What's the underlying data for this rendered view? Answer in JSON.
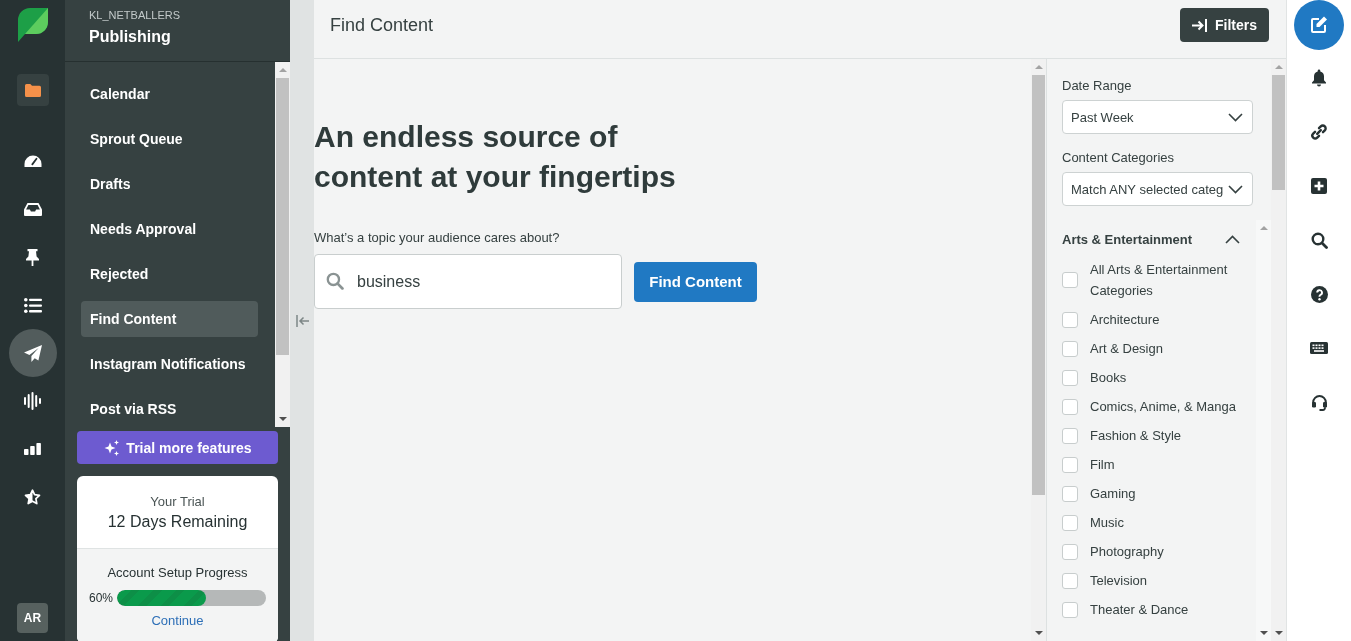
{
  "app_rail": {
    "nav": [
      {
        "selected": false
      },
      {
        "selected": false
      },
      {
        "selected": false
      },
      {
        "selected": false
      },
      {
        "selected": true
      },
      {
        "selected": false
      },
      {
        "selected": false
      },
      {
        "selected": false
      }
    ],
    "avatar": "AR"
  },
  "sidebar": {
    "account": "KL_NETBALLERS",
    "title": "Publishing",
    "items": [
      {
        "label": "Calendar",
        "selected": false
      },
      {
        "label": "Sprout Queue",
        "selected": false
      },
      {
        "label": "Drafts",
        "selected": false
      },
      {
        "label": "Needs Approval",
        "selected": false
      },
      {
        "label": "Rejected",
        "selected": false
      },
      {
        "label": "Find Content",
        "selected": true
      },
      {
        "label": "Instagram Notifications",
        "selected": false
      },
      {
        "label": "Post via RSS",
        "selected": false
      }
    ],
    "trial_button": "Trial more features",
    "trial_card": {
      "label": "Your Trial",
      "remaining": "12 Days Remaining",
      "progress_title": "Account Setup Progress",
      "progress": {
        "reading": "60%",
        "level": 0.6
      },
      "link": "Continue"
    }
  },
  "main": {
    "title": "Find Content",
    "filters_button": "Filters",
    "hero": {
      "headline": "An endless source of content at your fingertips",
      "search_label": "What’s a topic your audience cares about?",
      "search_value": "business",
      "search_button": "Find Content"
    }
  },
  "filters": {
    "date_range": {
      "label": "Date Range",
      "value": "Past Week"
    },
    "content_categories": {
      "label": "Content Categories",
      "value": "Match ANY selected categ"
    },
    "groups": [
      {
        "title": "Arts & Entertainment",
        "expanded": true,
        "items": [
          {
            "label": "All Arts & Entertainment Categories",
            "checked": false
          },
          {
            "label": "Architecture",
            "checked": false
          },
          {
            "label": "Art & Design",
            "checked": false
          },
          {
            "label": "Books",
            "checked": false
          },
          {
            "label": "Comics, Anime, & Manga",
            "checked": false
          },
          {
            "label": "Fashion & Style",
            "checked": false
          },
          {
            "label": "Film",
            "checked": false
          },
          {
            "label": "Gaming",
            "checked": false
          },
          {
            "label": "Music",
            "checked": false
          },
          {
            "label": "Photography",
            "checked": false
          },
          {
            "label": "Television",
            "checked": false
          },
          {
            "label": "Theater & Dance",
            "checked": false
          }
        ]
      }
    ]
  }
}
